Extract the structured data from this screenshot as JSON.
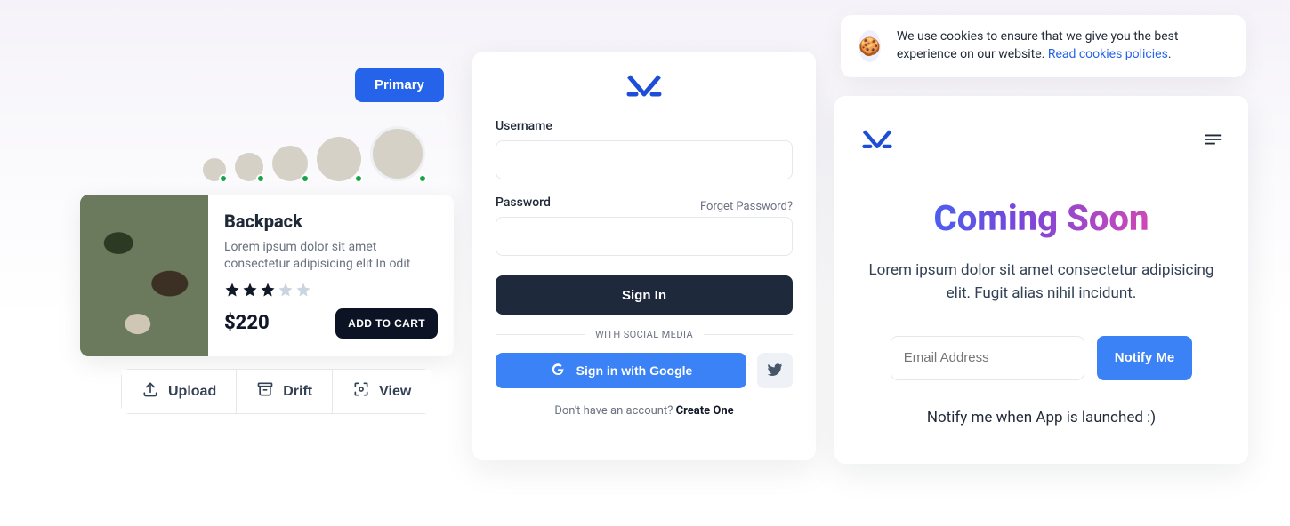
{
  "primary_button_label": "Primary",
  "product": {
    "title": "Backpack",
    "description": "Lorem ipsum dolor sit amet consectetur adipisicing elit In odit",
    "rating_filled": 3,
    "rating_total": 5,
    "price": "$220",
    "add_to_cart_label": "ADD TO CART"
  },
  "actions": {
    "upload": "Upload",
    "drift": "Drift",
    "view": "View"
  },
  "login": {
    "username_label": "Username",
    "password_label": "Password",
    "forget_label": "Forget Password?",
    "sign_in_label": "Sign In",
    "divider_label": "WITH SOCIAL MEDIA",
    "google_label": "Sign in with Google",
    "no_account_text": "Don't have an account? ",
    "create_label": "Create One"
  },
  "cookie": {
    "text": "We use cookies to ensure that we give you the best experience on our website. ",
    "link_label": "Read cookies policies",
    "period": "."
  },
  "soon": {
    "title": "Coming Soon",
    "description": "Lorem ipsum dolor sit amet consectetur adipisicing elit. Fugit alias nihil incidunt.",
    "email_placeholder": "Email Address",
    "notify_label": "Notify Me",
    "footer": "Notify me when App is launched :)"
  },
  "avatars": [
    {
      "id": "avatar-1"
    },
    {
      "id": "avatar-2"
    },
    {
      "id": "avatar-3"
    },
    {
      "id": "avatar-4"
    },
    {
      "id": "avatar-5"
    }
  ]
}
